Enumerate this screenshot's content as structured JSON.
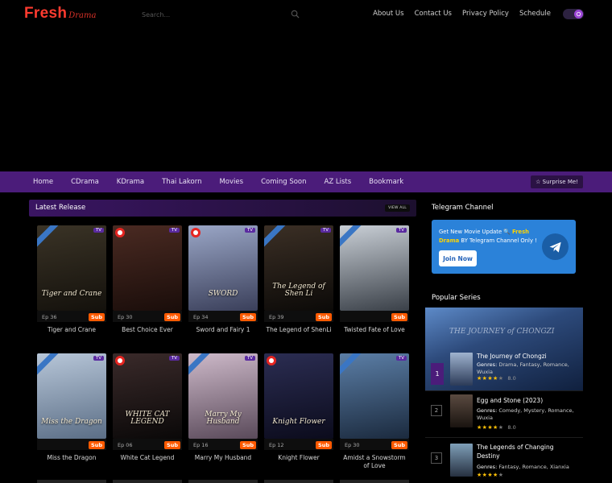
{
  "header": {
    "logo_main": "Fresh",
    "logo_script": "Drama",
    "search_placeholder": "Search...",
    "nav": [
      "About Us",
      "Contact Us",
      "Privacy Policy",
      "Schedule"
    ]
  },
  "mainnav": {
    "items": [
      "Home",
      "CDrama",
      "KDrama",
      "Thai Lakorn",
      "Movies",
      "Coming Soon",
      "AZ Lists",
      "Bookmark"
    ],
    "surprise_label": "☆ Surprise Me!"
  },
  "latest": {
    "title": "Latest Release",
    "view_all": "VIEW ALL",
    "cards": [
      {
        "name": "Tiger and Crane",
        "ep": "Ep 36",
        "badge": "Sub",
        "tv": "TV",
        "poster_text": "Tiger and Crane",
        "corner": "ribbon",
        "colors": [
          "#3a3326",
          "#14110c"
        ]
      },
      {
        "name": "Best Choice Ever",
        "ep": "Ep 30",
        "badge": "Sub",
        "tv": "TV",
        "poster_text": "",
        "corner": "logo",
        "colors": [
          "#4a2a22",
          "#1a0d0a"
        ]
      },
      {
        "name": "Sword and Fairy 1",
        "ep": "Ep 34",
        "badge": "Sub",
        "tv": "TV",
        "poster_text": "SWORD",
        "corner": "logo",
        "colors": [
          "#9aa6c6",
          "#3a3f5a"
        ]
      },
      {
        "name": "The Legend of ShenLi",
        "ep": "Ep 39",
        "badge": "Sub",
        "tv": "TV",
        "poster_text": "The Legend of Shen Li",
        "corner": "ribbon",
        "colors": [
          "#3b2f25",
          "#0c0a08"
        ]
      },
      {
        "name": "Twisted Fate of Love",
        "ep": "",
        "badge": "Sub",
        "tv": "TV",
        "poster_text": "",
        "corner": "ribbon",
        "colors": [
          "#c9cfd6",
          "#3a4048"
        ]
      },
      {
        "name": "Miss the Dragon",
        "ep": "",
        "badge": "Sub",
        "tv": "TV",
        "poster_text": "Miss the Dragon",
        "corner": "ribbon",
        "colors": [
          "#b7c6d8",
          "#5b6e86"
        ]
      },
      {
        "name": "White Cat Legend",
        "ep": "Ep 06",
        "badge": "Sub",
        "tv": "TV",
        "poster_text": "WHITE CAT LEGEND",
        "corner": "logo",
        "colors": [
          "#3a2a2a",
          "#0a0808"
        ]
      },
      {
        "name": "Marry My Husband",
        "ep": "Ep 16",
        "badge": "Sub",
        "tv": "TV",
        "poster_text": "Marry My Husband",
        "corner": "ribbon",
        "colors": [
          "#cdb9c9",
          "#5a4a5a"
        ]
      },
      {
        "name": "Knight Flower",
        "ep": "Ep 12",
        "badge": "Sub",
        "tv": "",
        "poster_text": "Knight Flower",
        "corner": "logo",
        "colors": [
          "#2b2d52",
          "#0b0b1c"
        ]
      },
      {
        "name": "Amidst a Snowstorm of Love",
        "ep": "Ep 30",
        "badge": "Sub",
        "tv": "TV",
        "poster_text": "",
        "corner": "ribbon",
        "colors": [
          "#5b7ea6",
          "#1b2a3e"
        ]
      }
    ]
  },
  "telegram": {
    "section_title": "Telegram Channel",
    "text_prefix": "Get New Movie Update 🔍",
    "text_highlight": "Fresh Drama",
    "text_suffix": "BY Telegram Channel Only !",
    "join_label": "Join Now"
  },
  "popular": {
    "section_title": "Popular Series",
    "feature_script": "THE JOURNEY of CHONGZI",
    "items": [
      {
        "rank": "1",
        "title": "The Journey of Chongzi",
        "genres_label": "Genres:",
        "genres": "Drama, Fantasy, Romance, Wuxia",
        "score": "8.0",
        "stars": 4
      },
      {
        "rank": "2",
        "title": "Egg and Stone (2023)",
        "genres_label": "Genres:",
        "genres": "Comedy, Mystery, Romance, Wuxia",
        "score": "8.0",
        "stars": 4
      },
      {
        "rank": "3",
        "title": "The Legends of Changing Destiny",
        "genres_label": "Genres:",
        "genres": "Fantasy, Romance, Xianxia",
        "score": "",
        "stars": 4
      }
    ]
  }
}
